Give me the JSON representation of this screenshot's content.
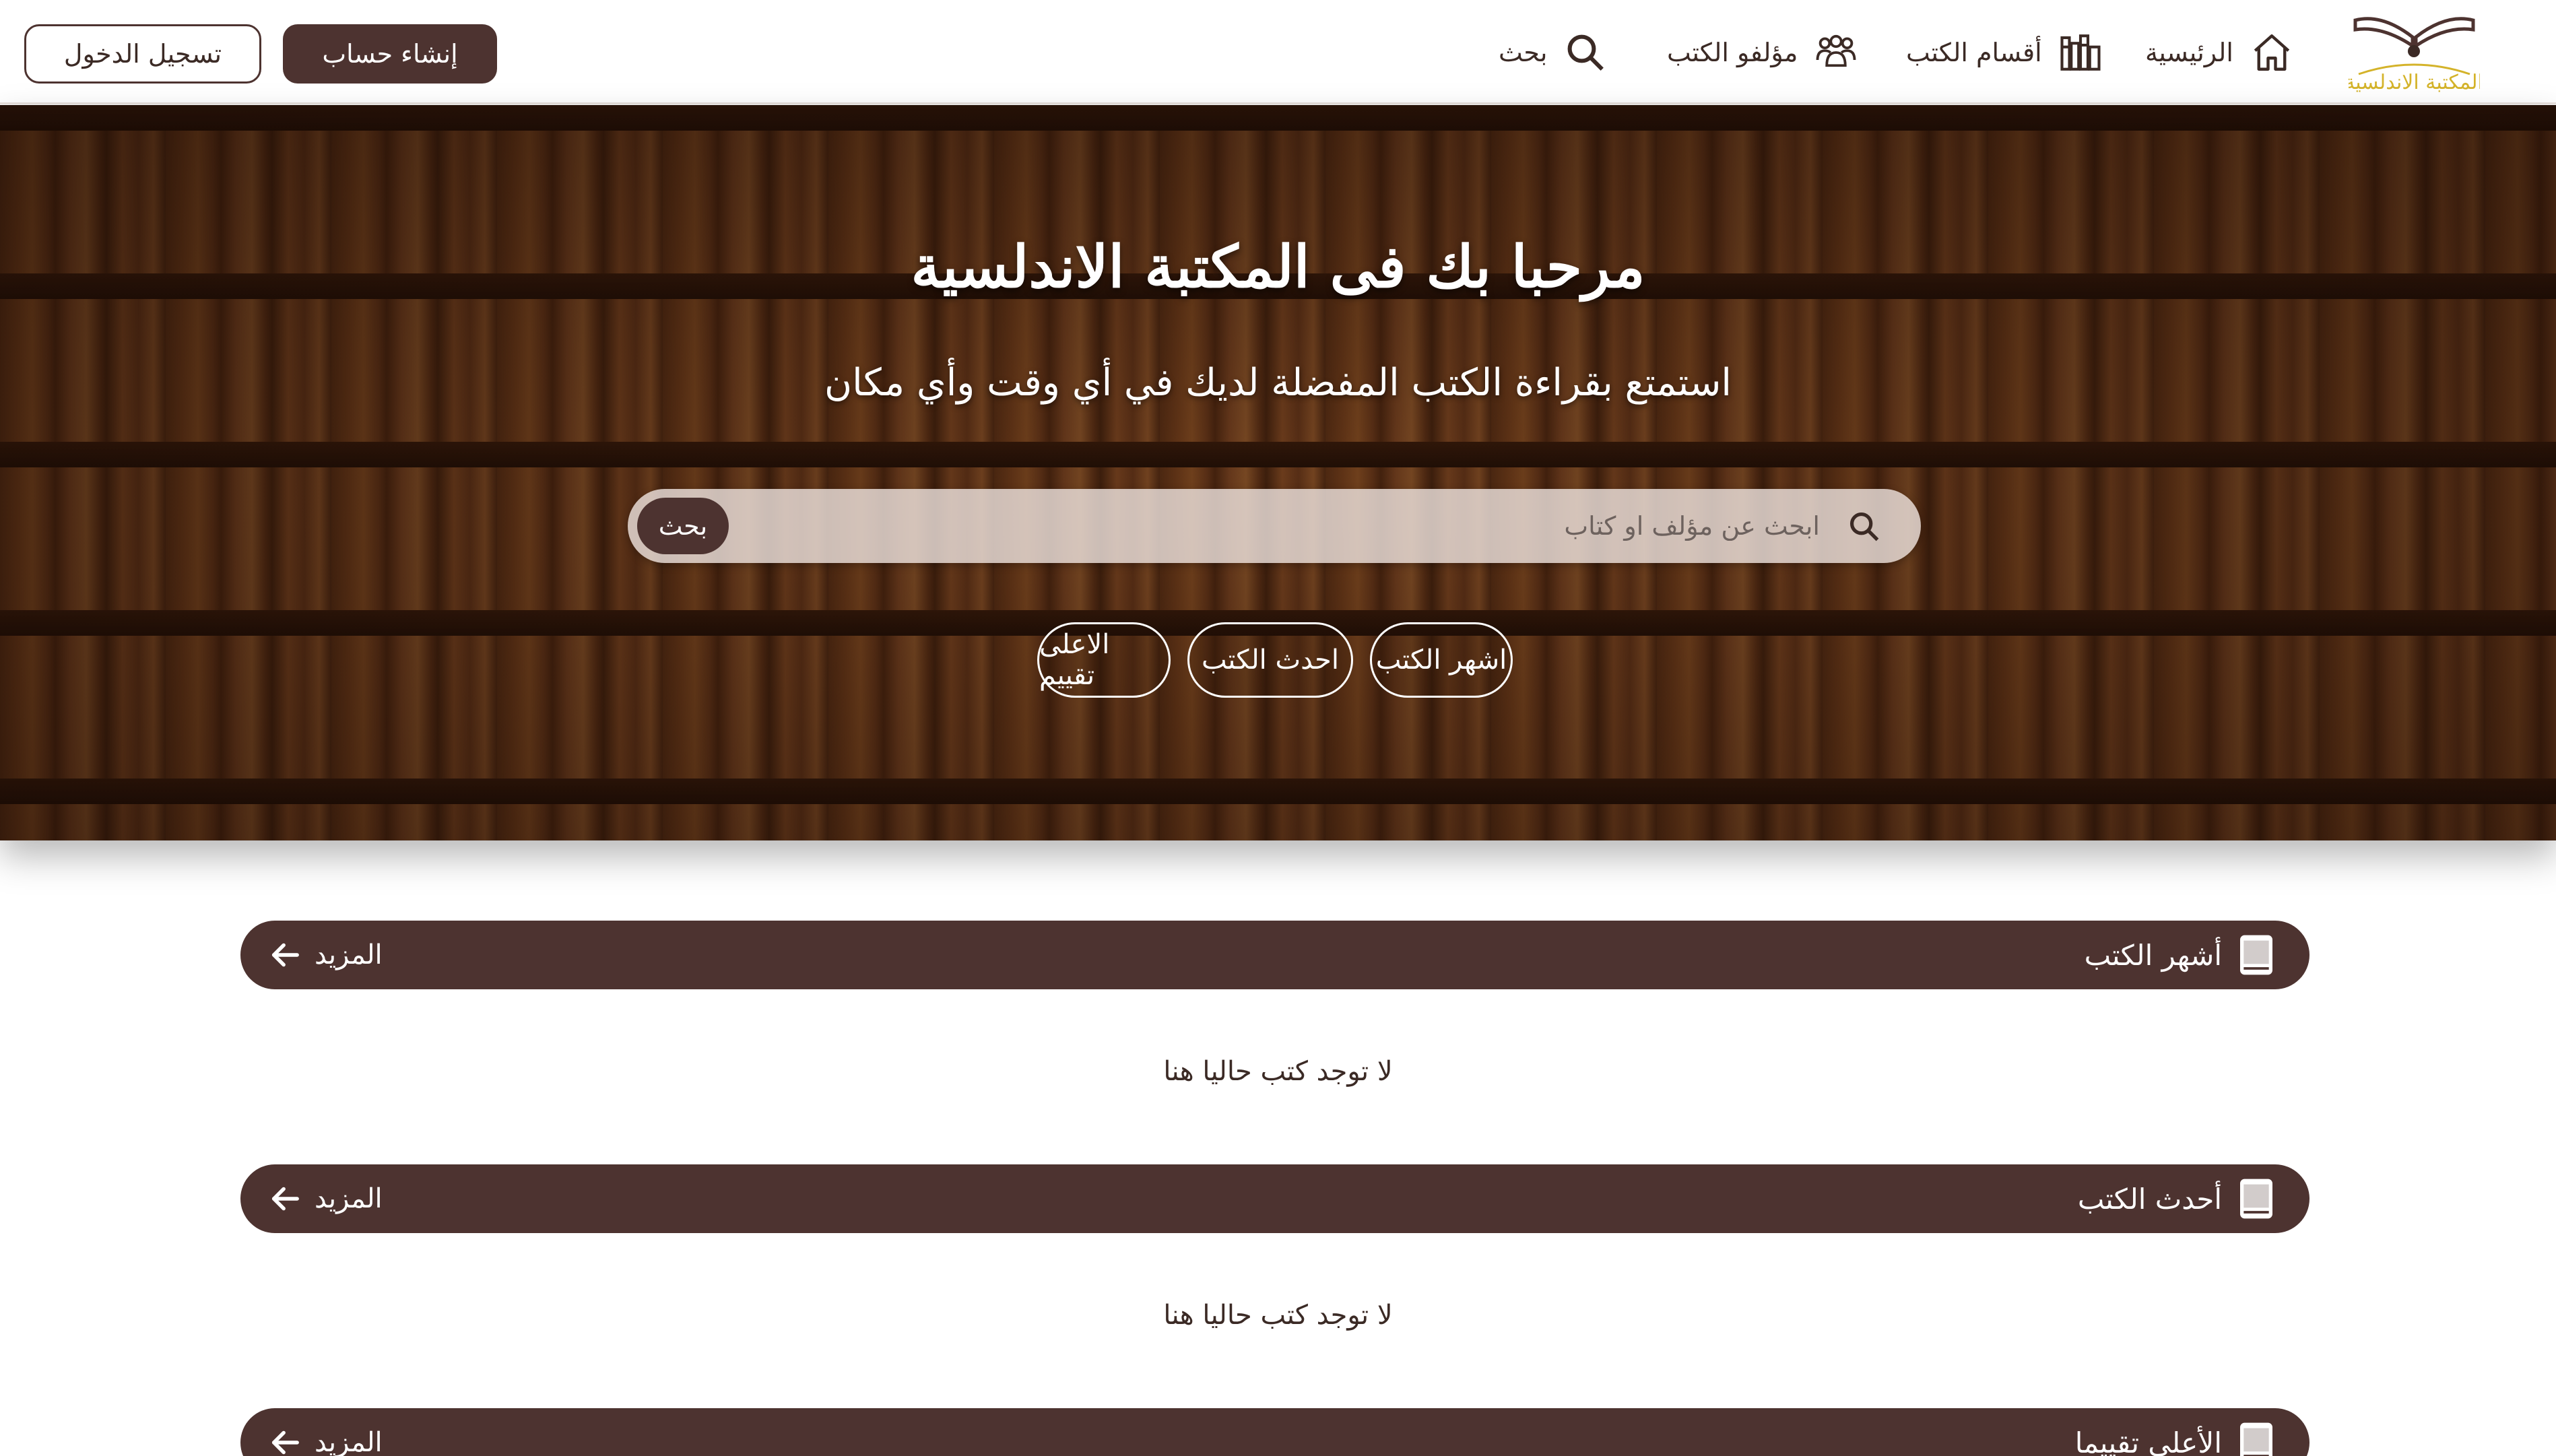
{
  "header": {
    "logo_text": "المكتبة الاندلسية",
    "nav": {
      "home": "الرئيسية",
      "sections": "أقسام الكتب",
      "authors": "مؤلفو الكتب",
      "search": "بحث"
    },
    "signup_label": "إنشاء حساب",
    "login_label": "تسجيل الدخول"
  },
  "hero": {
    "title": "مرحبا بك فى المكتبة الاندلسية",
    "subtitle": "استمتع بقراءة الكتب المفضلة لديك في أي وقت وأي مكان",
    "search": {
      "placeholder": "ابحث عن مؤلف او كتاب",
      "button_label": "بحث"
    },
    "filters": {
      "popular": "اشهر الكتب",
      "newest": "احدث الكتب",
      "top_rated": "الاعلى تقييم"
    }
  },
  "sections": [
    {
      "title": "أشهر الكتب",
      "more_label": "المزيد",
      "empty_text": "لا توجد كتب حاليا هنا"
    },
    {
      "title": "أحدث الكتب",
      "more_label": "المزيد",
      "empty_text": "لا توجد كتب حاليا هنا"
    },
    {
      "title": "الأعلى تقييما",
      "more_label": "المزيد"
    }
  ],
  "colors": {
    "primary_brown": "#4d3330",
    "logo_gold": "#d4b32a",
    "white": "#ffffff"
  },
  "icons": {
    "logo": "open-book-logo-icon",
    "home": "home-icon",
    "sections": "library-shelf-icon",
    "authors": "people-group-icon",
    "search": "search-icon",
    "section": "book-icon",
    "more": "arrow-left-icon"
  }
}
